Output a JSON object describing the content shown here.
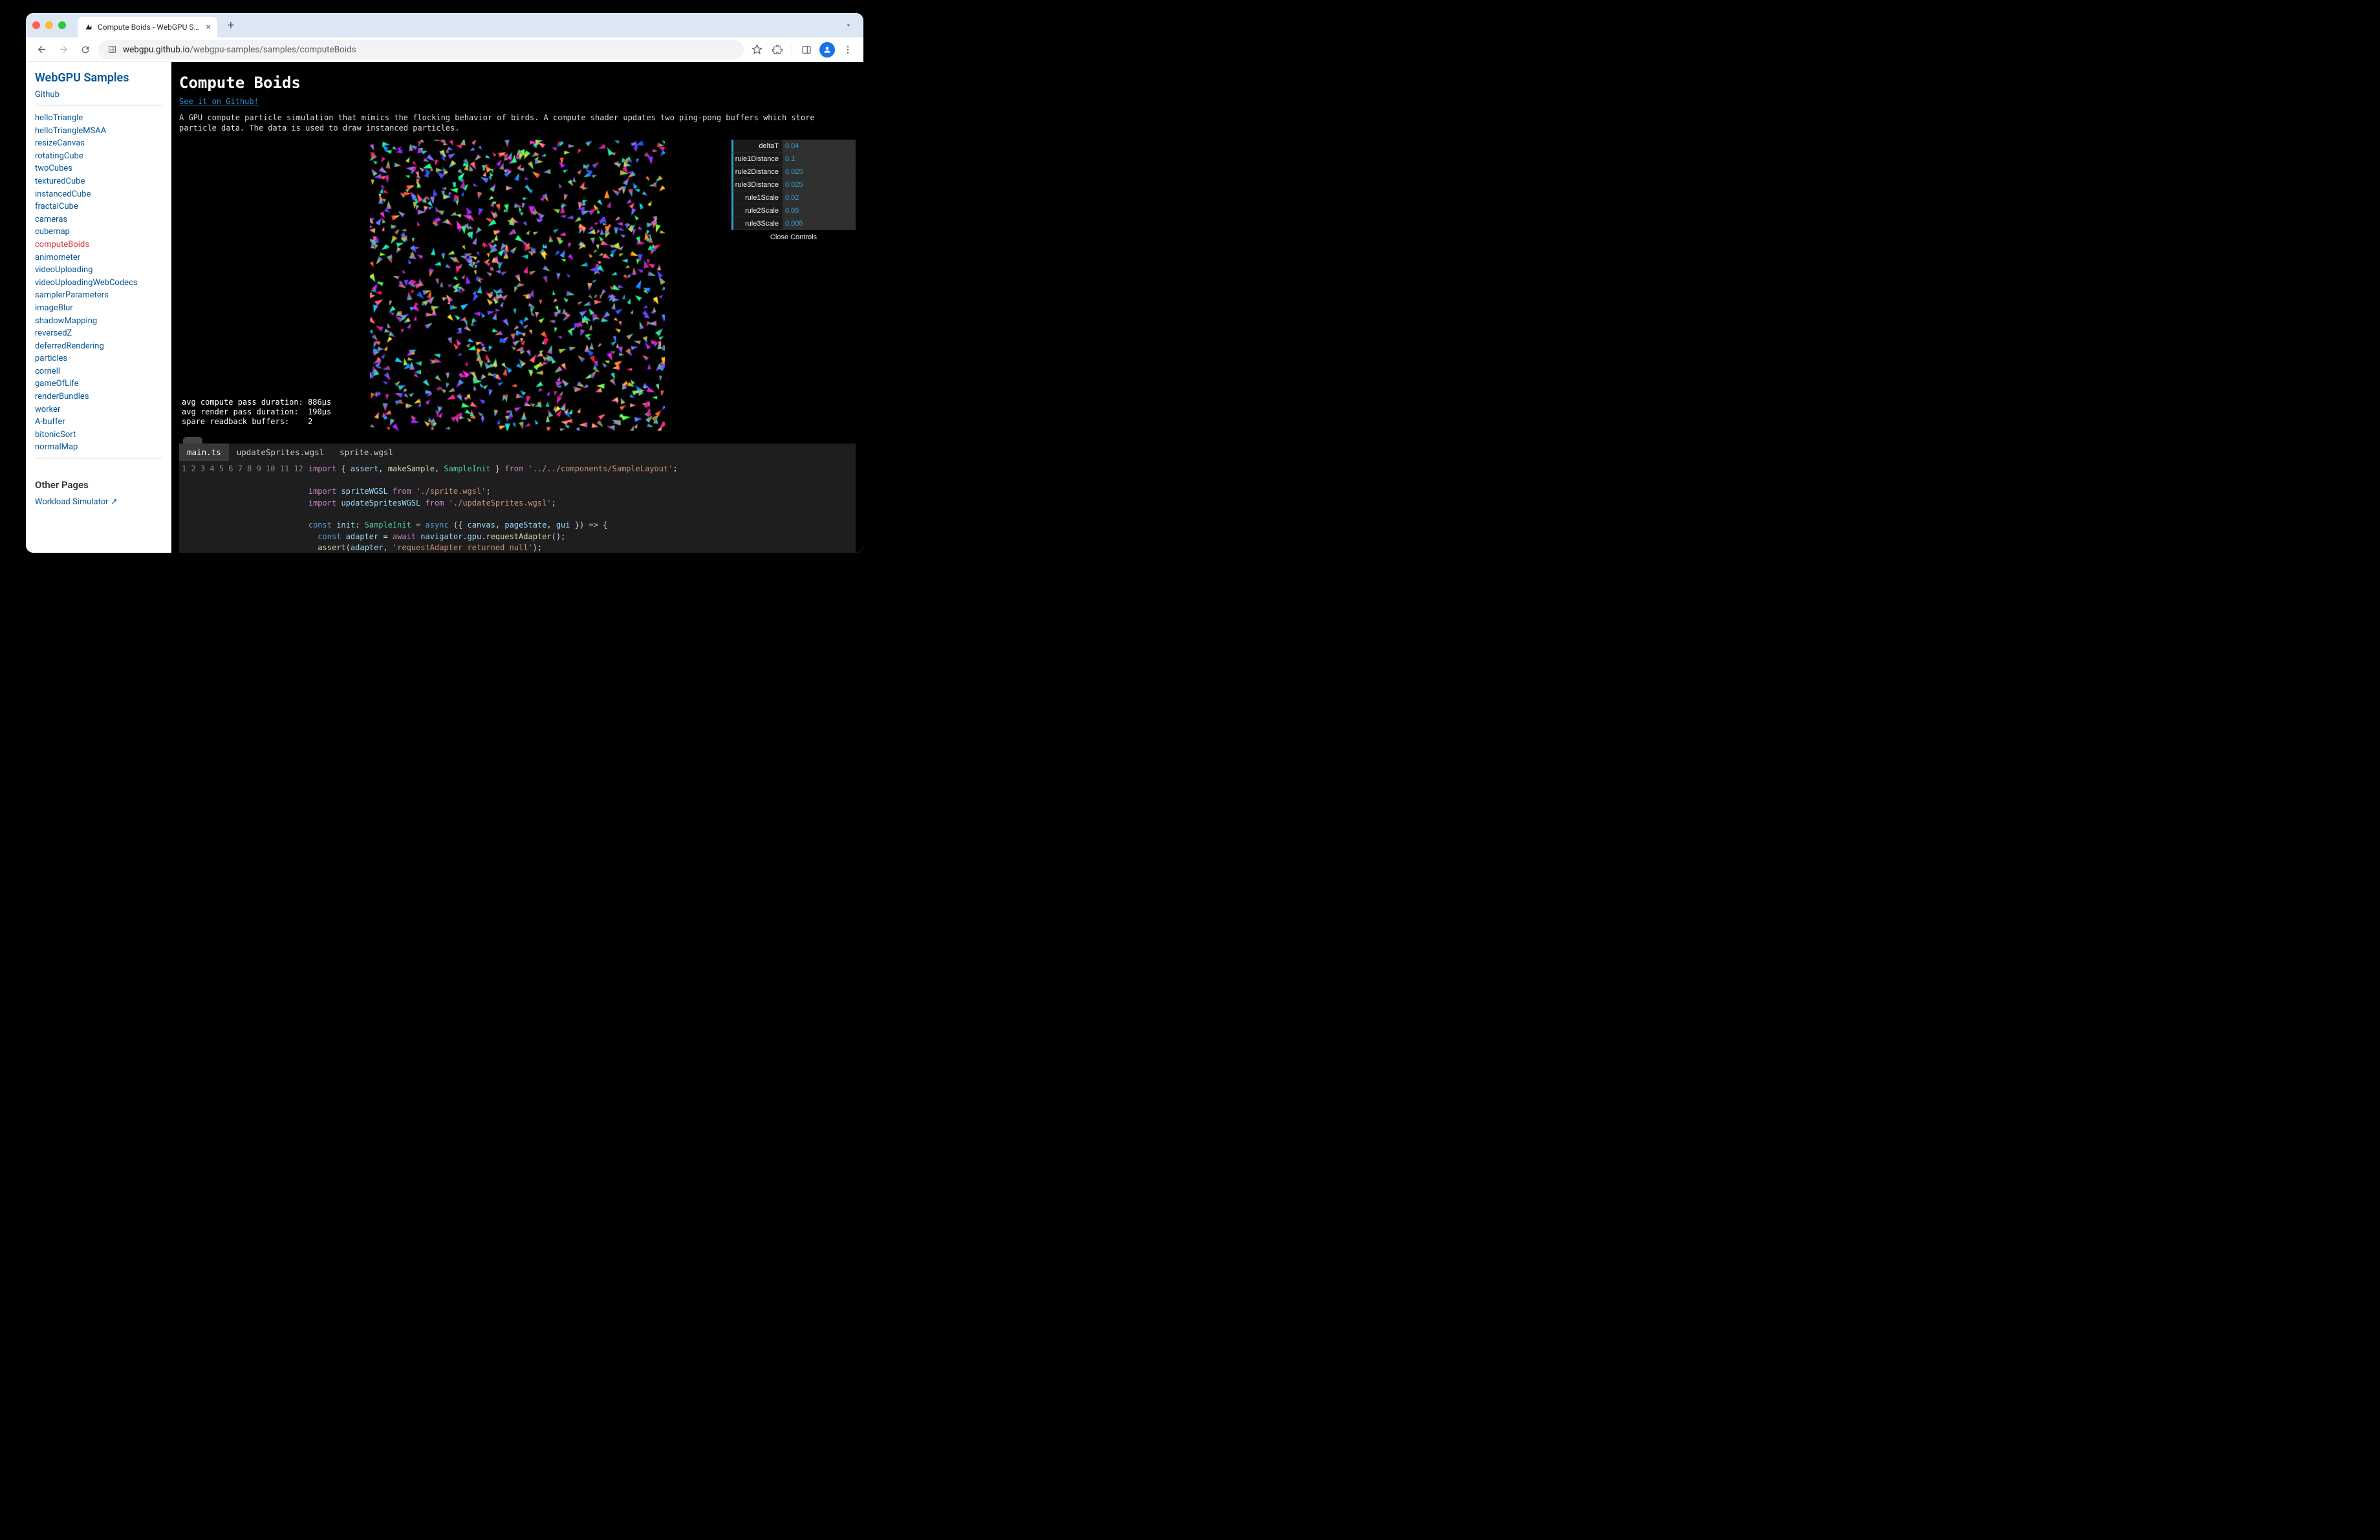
{
  "browser": {
    "tab_title": "Compute Boids - WebGPU S…",
    "url_host": "webgpu.github.io",
    "url_path": "/webgpu-samples/samples/computeBoids"
  },
  "sidebar": {
    "title": "WebGPU Samples",
    "github_label": "Github",
    "items": [
      "helloTriangle",
      "helloTriangleMSAA",
      "resizeCanvas",
      "rotatingCube",
      "twoCubes",
      "texturedCube",
      "instancedCube",
      "fractalCube",
      "cameras",
      "cubemap",
      "computeBoids",
      "animometer",
      "videoUploading",
      "videoUploadingWebCodecs",
      "samplerParameters",
      "imageBlur",
      "shadowMapping",
      "reversedZ",
      "deferredRendering",
      "particles",
      "cornell",
      "gameOfLife",
      "renderBundles",
      "worker",
      "A-buffer",
      "bitonicSort",
      "normalMap"
    ],
    "active_index": 10,
    "other_pages_title": "Other Pages",
    "other_pages": [
      "Workload Simulator ↗"
    ]
  },
  "page": {
    "heading": "Compute Boids",
    "github_link": "See it on Github!",
    "description": "A GPU compute particle simulation that mimics the flocking behavior of birds. A compute shader updates two ping-pong buffers which store particle data. The data is used to draw instanced particles."
  },
  "gui": {
    "rows": [
      {
        "label": "deltaT",
        "value": "0.04"
      },
      {
        "label": "rule1Distance",
        "value": "0.1"
      },
      {
        "label": "rule2Distance",
        "value": "0.025"
      },
      {
        "label": "rule3Distance",
        "value": "0.025"
      },
      {
        "label": "rule1Scale",
        "value": "0.02"
      },
      {
        "label": "rule2Scale",
        "value": "0.05"
      },
      {
        "label": "rule3Scale",
        "value": "0.005"
      }
    ],
    "close_label": "Close Controls"
  },
  "stats": {
    "text": "avg compute pass duration: 886µs\navg render pass duration:  190µs\nspare readback buffers:    2"
  },
  "code": {
    "tabs": [
      "main.ts",
      "updateSprites.wgsl",
      "sprite.wgsl"
    ],
    "active_tab": 0,
    "line_start": 1,
    "line_end": 12
  }
}
